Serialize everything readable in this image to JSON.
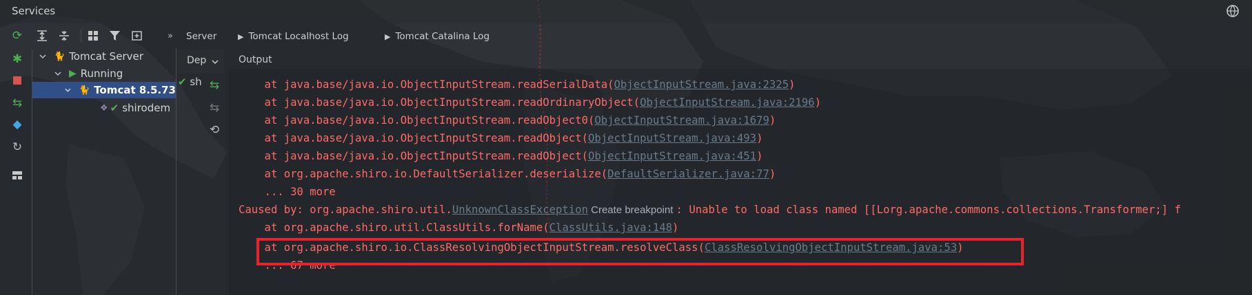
{
  "window": {
    "title": "Services"
  },
  "tabs": [
    {
      "label": "Server"
    },
    {
      "label": "Tomcat Localhost Log"
    },
    {
      "label": "Tomcat Catalina Log"
    }
  ],
  "subpanel": {
    "deployment_label": "Dep",
    "output_label": "Output",
    "artifact_short": "sh"
  },
  "tree": {
    "root": "Tomcat Server",
    "running": "Running",
    "instance": "Tomcat 8.5.73",
    "artifact": "shirodem"
  },
  "console": {
    "lines": [
      {
        "prefix": "    at java.base/java.io.ObjectInputStream.readSerialData(",
        "link": "ObjectInputStream.java:2325",
        "suffix": ")"
      },
      {
        "prefix": "    at java.base/java.io.ObjectInputStream.readOrdinaryObject(",
        "link": "ObjectInputStream.java:2196",
        "suffix": ")"
      },
      {
        "prefix": "    at java.base/java.io.ObjectInputStream.readObject0(",
        "link": "ObjectInputStream.java:1679",
        "suffix": ")"
      },
      {
        "prefix": "    at java.base/java.io.ObjectInputStream.readObject(",
        "link": "ObjectInputStream.java:493",
        "suffix": ")"
      },
      {
        "prefix": "    at java.base/java.io.ObjectInputStream.readObject(",
        "link": "ObjectInputStream.java:451",
        "suffix": ")"
      },
      {
        "prefix": "    at org.apache.shiro.io.DefaultSerializer.deserialize(",
        "link": "DefaultSerializer.java:77",
        "suffix": ")"
      },
      {
        "prefix": "    ... 30 more",
        "link": "",
        "suffix": ""
      }
    ],
    "caused_by": {
      "prefix": "Caused by: org.apache.shiro.util.",
      "link": "UnknownClassException",
      "hint": " Create breakpoint ",
      "suffix": ": Unable to load class named [[Lorg.apache.commons.collections.Transformer;] f"
    },
    "after_lines": [
      {
        "prefix": "    at org.apache.shiro.util.ClassUtils.forName(",
        "link": "ClassUtils.java:148",
        "suffix": ")"
      },
      {
        "prefix": "    at org.apache.shiro.io.ClassResolvingObjectInputStream.resolveClass(",
        "link": "ClassResolvingObjectInputStream.java:53",
        "suffix": ")"
      },
      {
        "prefix": "    ... 67 more",
        "link": "",
        "suffix": ""
      }
    ]
  },
  "colors": {
    "error_text": "#ff6b68",
    "link": "#6a7b8c",
    "highlight_box": "#e8232d",
    "selected_row": "#2f4f86",
    "running_green": "#4caf50"
  }
}
